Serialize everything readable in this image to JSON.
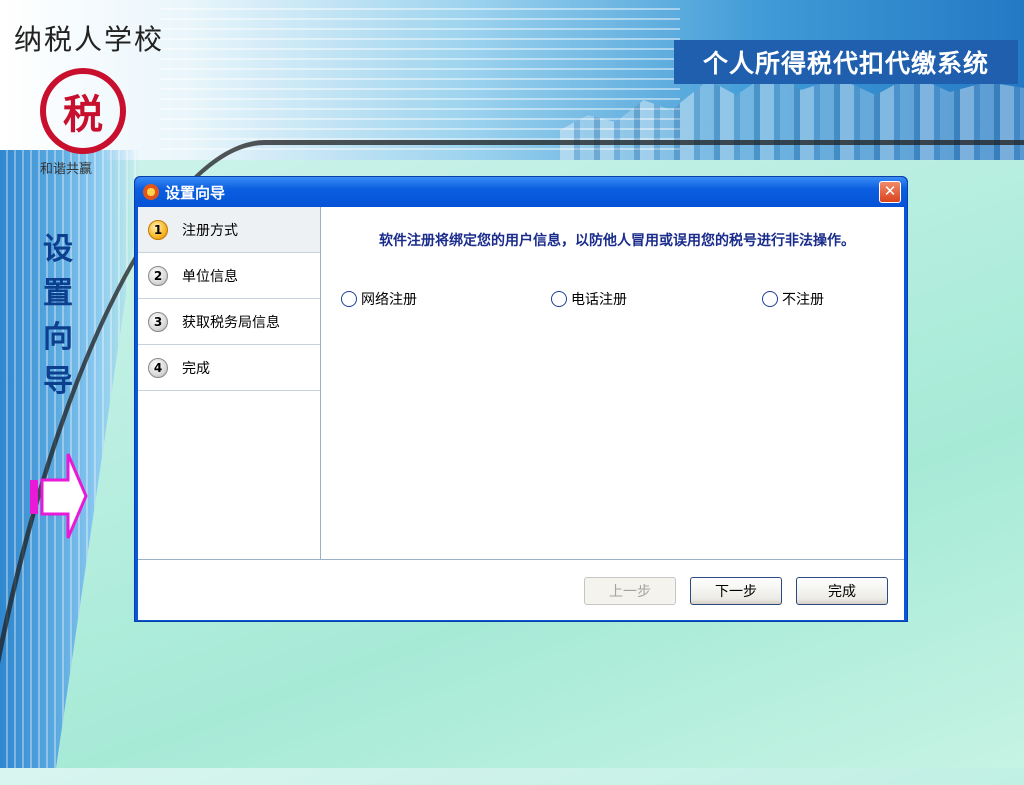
{
  "slide": {
    "logo_text": "纳税人学校",
    "logo_seal": "税",
    "logo_sub": "和谐共赢",
    "system_title": "个人所得税代扣代缴系统",
    "side_title": [
      "设",
      "置",
      "向",
      "导"
    ]
  },
  "dialog": {
    "title": "设置向导",
    "close_symbol": "✕",
    "steps": [
      {
        "num": "1",
        "label": "注册方式",
        "active": true
      },
      {
        "num": "2",
        "label": "单位信息",
        "active": false
      },
      {
        "num": "3",
        "label": "获取税务局信息",
        "active": false
      },
      {
        "num": "4",
        "label": "完成",
        "active": false
      }
    ],
    "description": "软件注册将绑定您的用户信息，以防他人冒用或误用您的税号进行非法操作。",
    "options": [
      "网络注册",
      "电话注册",
      "不注册"
    ],
    "buttons": {
      "prev": "上一步",
      "next": "下一步",
      "finish": "完成"
    }
  },
  "colors": {
    "title_bg": "#1f5fae",
    "dialog_blue": "#0a56d8",
    "arrow_magenta": "#e81ad8"
  }
}
